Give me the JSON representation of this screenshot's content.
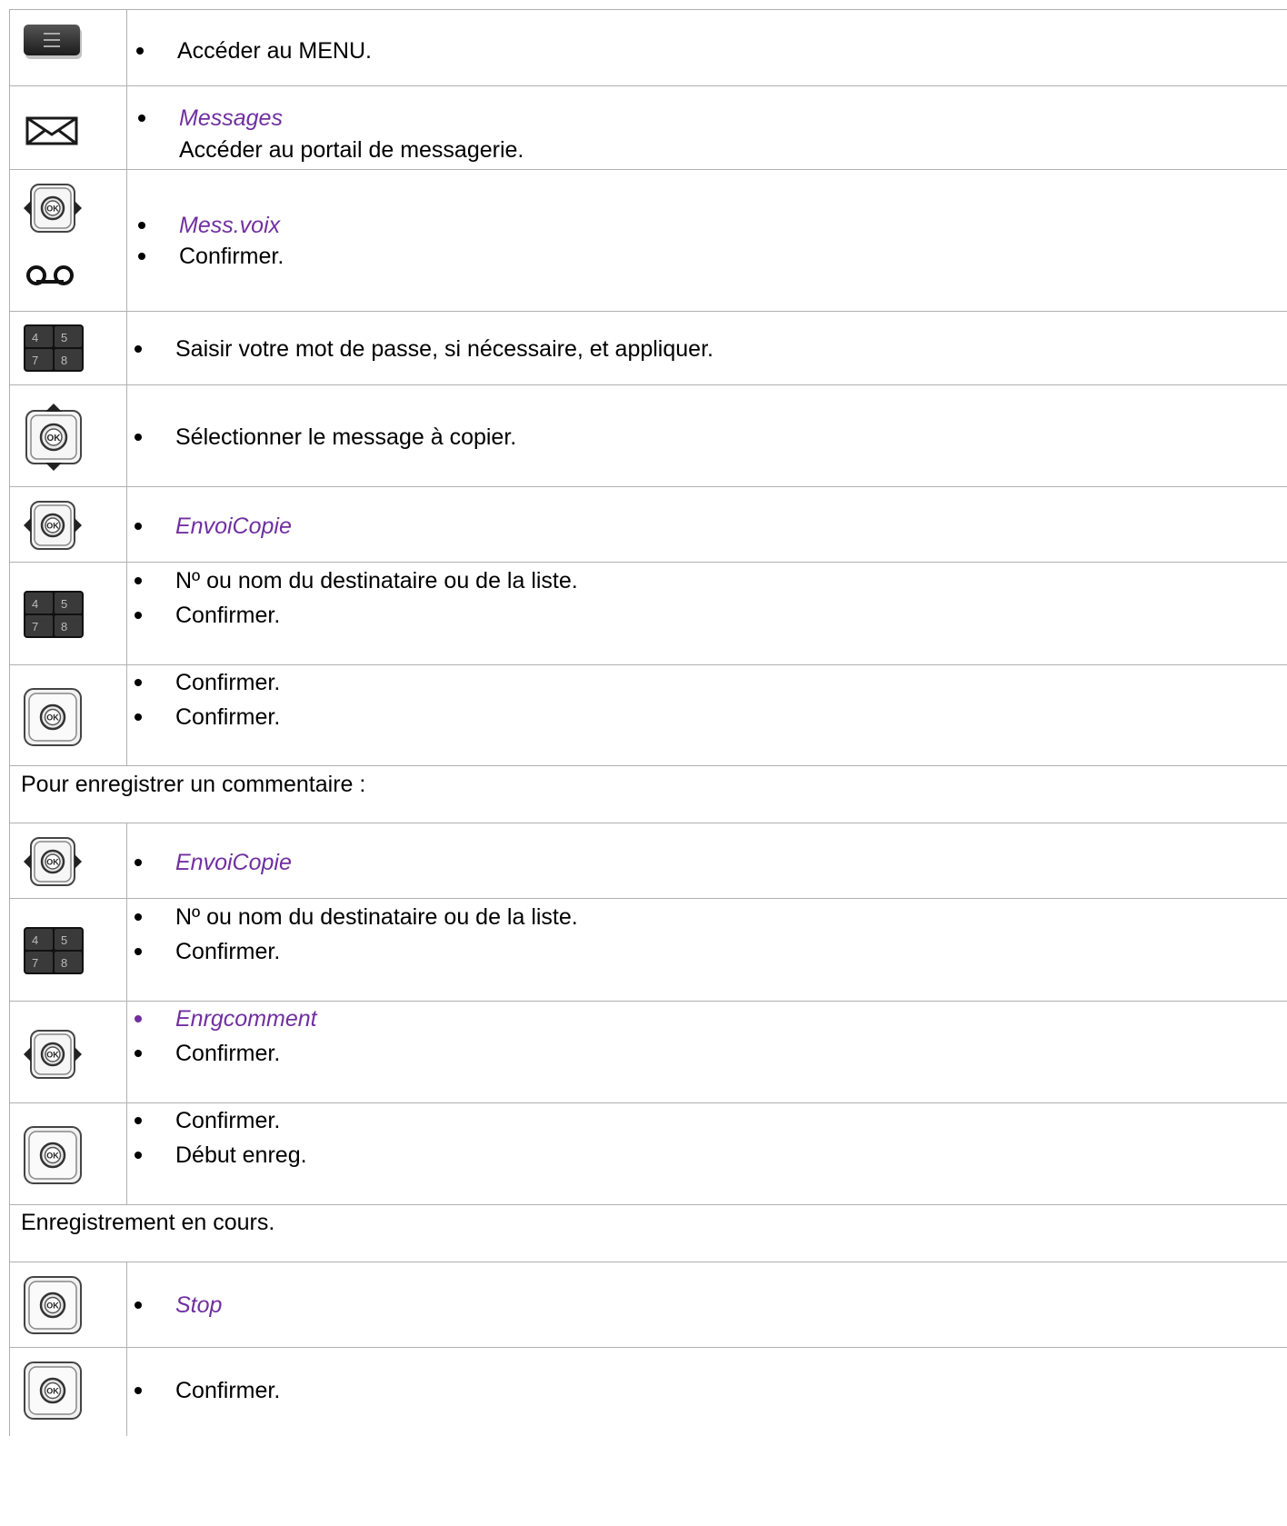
{
  "rows": [
    {
      "icon": "menu-key-icon",
      "items": [
        {
          "text": "Accéder au MENU.",
          "style": "normal"
        }
      ]
    },
    {
      "icon": "envelope-icon",
      "items": [
        {
          "text": "Messages",
          "style": "softkey"
        }
      ],
      "subtext": "Accéder au portail de messagerie."
    },
    {
      "icon": "navigator-left-right-ok-icon",
      "icon2": "voicemail-icon",
      "items": [
        {
          "text": "Mess.voix",
          "style": "softkey"
        },
        {
          "text": "Confirmer.",
          "style": "normal"
        }
      ]
    },
    {
      "icon": "keypad-icon",
      "items": [
        {
          "text": "Saisir votre mot de passe, si nécessaire, et appliquer.",
          "style": "normal"
        }
      ]
    },
    {
      "icon": "navigator-up-down-ok-icon",
      "items": [
        {
          "text": "Sélectionner le message à copier.",
          "style": "normal"
        }
      ]
    },
    {
      "icon": "navigator-left-right-ok-icon",
      "items": [
        {
          "text": "EnvoiCopie",
          "style": "softkey"
        }
      ]
    },
    {
      "icon": "keypad-icon",
      "items": [
        {
          "text": "Nº ou nom du destinataire ou de la liste.",
          "style": "normal"
        },
        {
          "text": "Confirmer.",
          "style": "normal"
        }
      ]
    },
    {
      "icon": "ok-key-icon",
      "items": [
        {
          "text": "Confirmer.",
          "style": "normal"
        },
        {
          "text": "Confirmer.",
          "style": "normal"
        }
      ]
    },
    {
      "note": "Pour enregistrer un commentaire :"
    },
    {
      "icon": "navigator-left-right-ok-icon",
      "items": [
        {
          "text": "EnvoiCopie",
          "style": "softkey"
        }
      ]
    },
    {
      "icon": "keypad-icon",
      "items": [
        {
          "text": "Nº ou nom du destinataire ou de la liste.",
          "style": "normal"
        },
        {
          "text": "Confirmer.",
          "style": "normal"
        }
      ]
    },
    {
      "icon": "navigator-left-right-ok-icon",
      "items": [
        {
          "text": "Enrgcomment",
          "style": "softkey"
        },
        {
          "text": "Confirmer.",
          "style": "normal"
        }
      ]
    },
    {
      "icon": "ok-key-icon",
      "items": [
        {
          "text": "Confirmer.",
          "style": "normal"
        },
        {
          "text": "Début enreg.",
          "style": "normal"
        }
      ]
    },
    {
      "note": "Enregistrement en cours."
    },
    {
      "icon": "ok-key-icon",
      "items": [
        {
          "text": "Stop",
          "style": "softkey"
        }
      ]
    },
    {
      "icon": "ok-key-icon",
      "items": [
        {
          "text": "Confirmer.",
          "style": "normal"
        }
      ]
    }
  ],
  "colors": {
    "softkey": "#7030a0",
    "border": "#b0b0b0",
    "key_dark": "#2b2b2b"
  },
  "icon_labels": {
    "ok": "OK",
    "keypad": [
      "4",
      "5",
      "7",
      "8"
    ]
  }
}
